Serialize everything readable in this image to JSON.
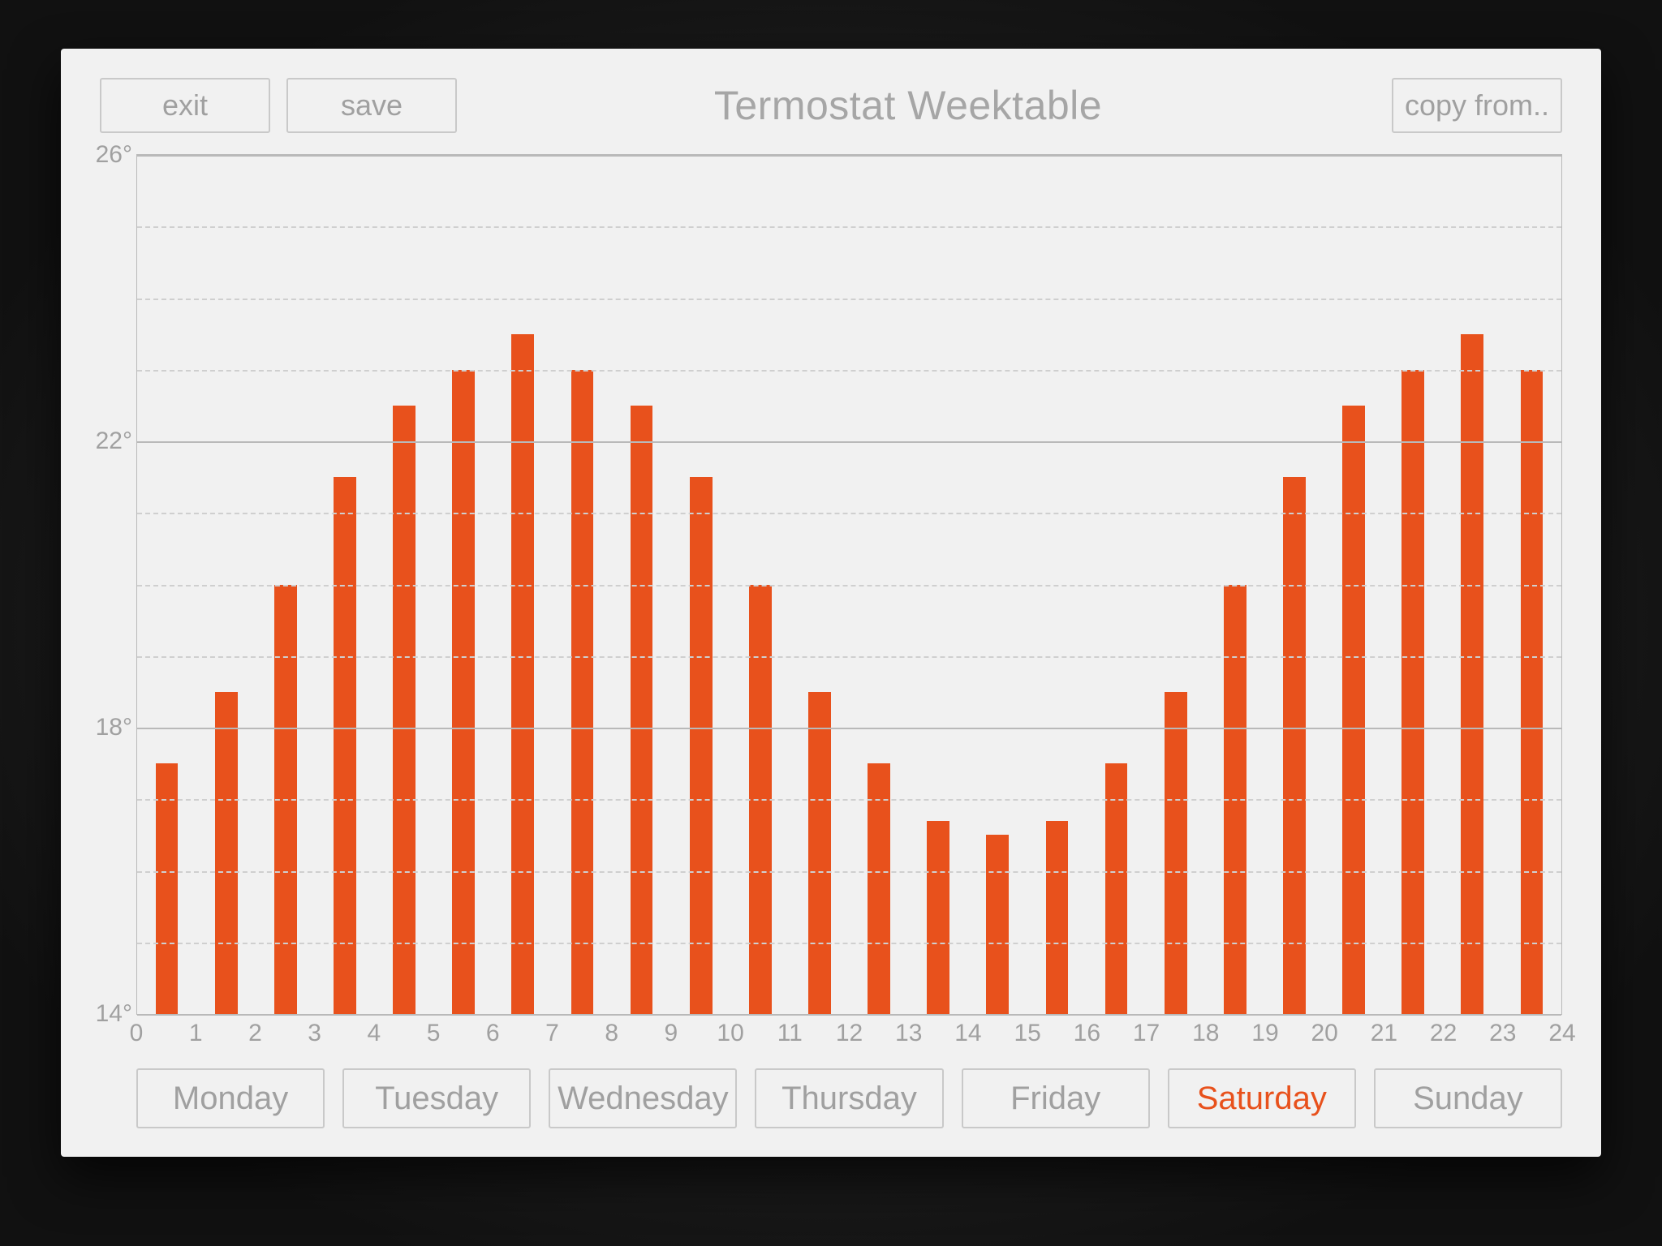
{
  "title": "Termostat Weektable",
  "buttons": {
    "exit": "exit",
    "save": "save",
    "copy_from": "copy from.."
  },
  "days": [
    {
      "label": "Monday",
      "active": false
    },
    {
      "label": "Tuesday",
      "active": false
    },
    {
      "label": "Wednesday",
      "active": false
    },
    {
      "label": "Thursday",
      "active": false
    },
    {
      "label": "Friday",
      "active": false
    },
    {
      "label": "Saturday",
      "active": true
    },
    {
      "label": "Sunday",
      "active": false
    }
  ],
  "colors": {
    "bar": "#e8511c",
    "active_day": "#e8511c",
    "muted_text": "#a0a0a0",
    "border": "#c9c9c9",
    "panel_bg": "#f1f1f1"
  },
  "chart_data": {
    "type": "bar",
    "title": "Termostat Weektable",
    "xlabel": "",
    "ylabel": "",
    "x_ticks": [
      0,
      1,
      2,
      3,
      4,
      5,
      6,
      7,
      8,
      9,
      10,
      11,
      12,
      13,
      14,
      15,
      16,
      17,
      18,
      19,
      20,
      21,
      22,
      23,
      24
    ],
    "y_ticks": [
      14,
      18,
      22,
      26
    ],
    "y_tick_labels": [
      "14°",
      "18°",
      "22°",
      "26°"
    ],
    "y_minor_step": 1,
    "ylim": [
      14,
      26
    ],
    "categories": [
      0,
      1,
      2,
      3,
      4,
      5,
      6,
      7,
      8,
      9,
      10,
      11,
      12,
      13,
      14,
      15,
      16,
      17,
      18,
      19,
      20,
      21,
      22,
      23
    ],
    "values": [
      17.5,
      18.5,
      20.0,
      21.5,
      22.5,
      23.0,
      23.5,
      23.0,
      22.5,
      21.5,
      20.0,
      18.5,
      17.5,
      16.7,
      16.5,
      16.7,
      17.5,
      18.5,
      20.0,
      21.5,
      22.5,
      23.0,
      23.5,
      23.0
    ],
    "series": [
      {
        "name": "Saturday",
        "values": [
          17.5,
          18.5,
          20.0,
          21.5,
          22.5,
          23.0,
          23.5,
          23.0,
          22.5,
          21.5,
          20.0,
          18.5,
          17.5,
          16.7,
          16.5,
          16.7,
          17.5,
          18.5,
          20.0,
          21.5,
          22.5,
          23.0,
          23.5,
          23.0
        ]
      }
    ],
    "bar_color": "#e8511c"
  }
}
